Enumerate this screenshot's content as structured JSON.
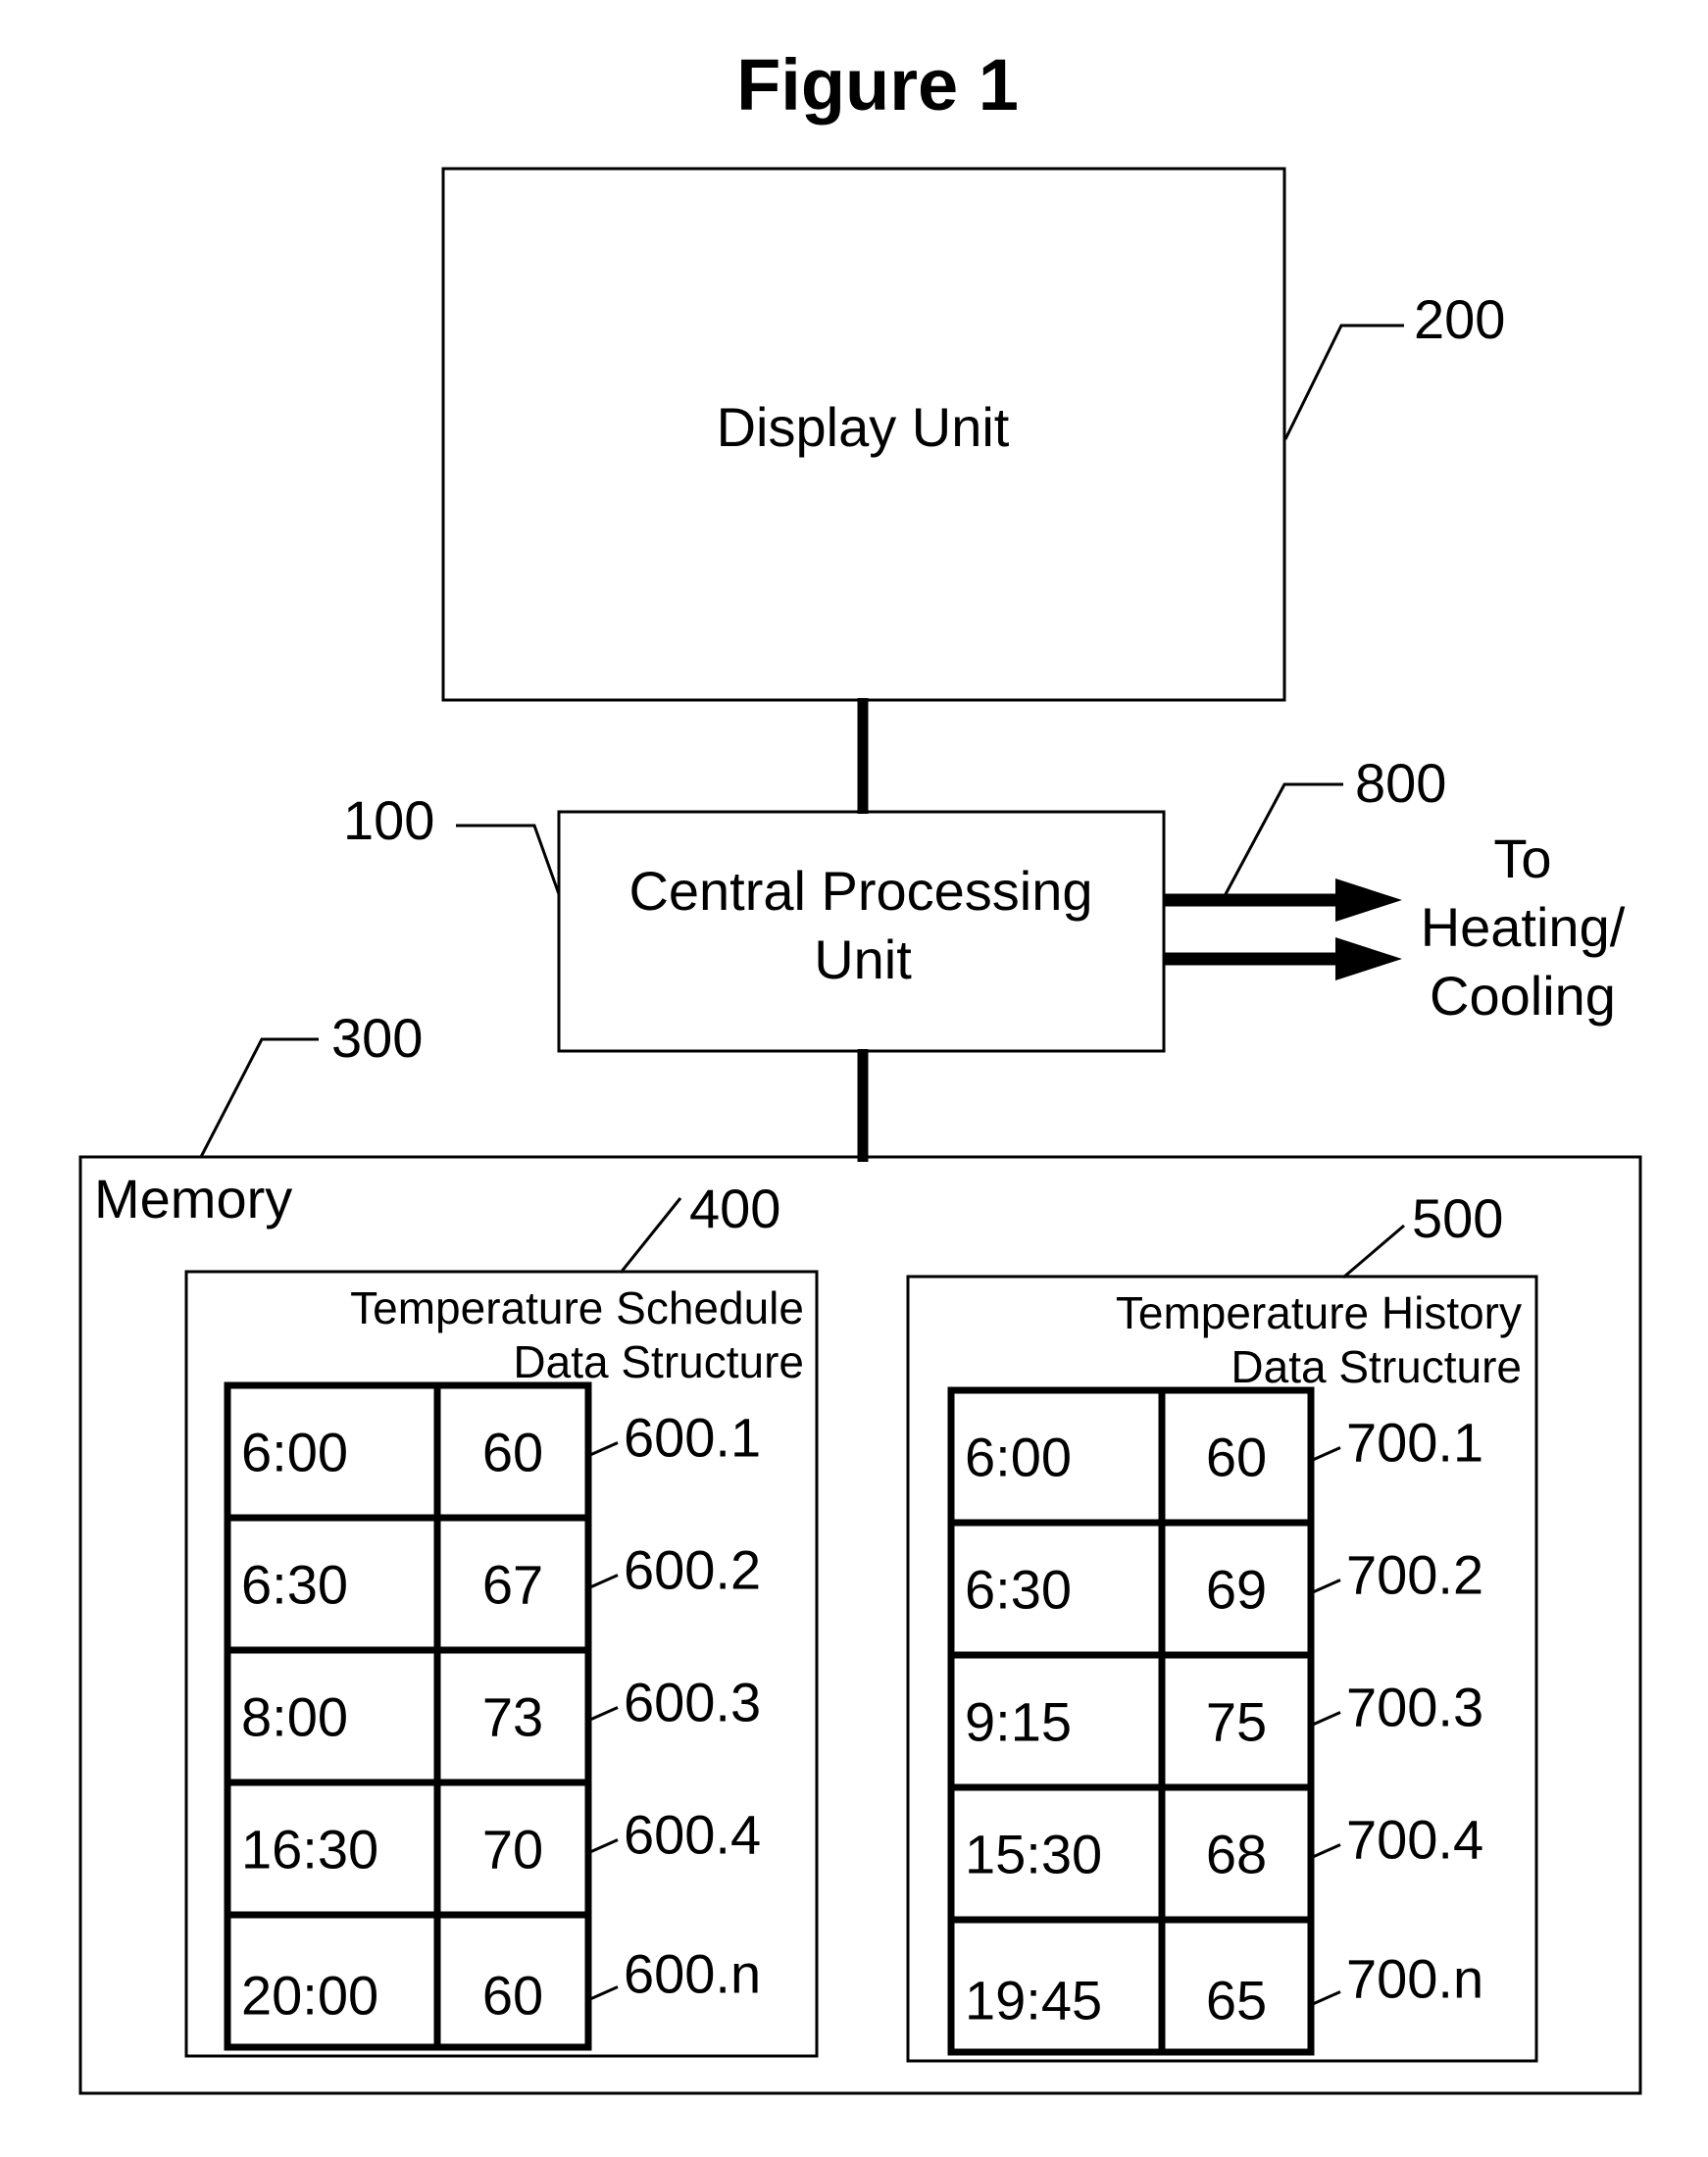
{
  "figure": {
    "title": "Figure 1"
  },
  "display_unit": {
    "label": "Display Unit",
    "ref": "200"
  },
  "cpu": {
    "label_line1": "Central Processing",
    "label_line2": "Unit",
    "ref": "100"
  },
  "output": {
    "ref": "800",
    "label_line1": "To",
    "label_line2": "Heating/",
    "label_line3": "Cooling"
  },
  "memory": {
    "label": "Memory",
    "ref": "300"
  },
  "schedule": {
    "ref": "400",
    "title_line1": "Temperature Schedule",
    "title_line2": "Data Structure",
    "rows": [
      {
        "time": "6:00",
        "temp": "60",
        "ref": "600.1"
      },
      {
        "time": "6:30",
        "temp": "67",
        "ref": "600.2"
      },
      {
        "time": "8:00",
        "temp": "73",
        "ref": "600.3"
      },
      {
        "time": "16:30",
        "temp": "70",
        "ref": "600.4"
      },
      {
        "time": "20:00",
        "temp": "60",
        "ref": "600.n"
      }
    ]
  },
  "history": {
    "ref": "500",
    "title_line1": "Temperature History",
    "title_line2": "Data Structure",
    "rows": [
      {
        "time": "6:00",
        "temp": "60",
        "ref": "700.1"
      },
      {
        "time": "6:30",
        "temp": "69",
        "ref": "700.2"
      },
      {
        "time": "9:15",
        "temp": "75",
        "ref": "700.3"
      },
      {
        "time": "15:30",
        "temp": "68",
        "ref": "700.4"
      },
      {
        "time": "19:45",
        "temp": "65",
        "ref": "700.n"
      }
    ]
  }
}
